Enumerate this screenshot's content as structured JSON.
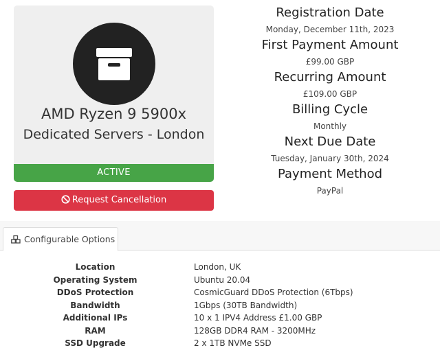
{
  "product": {
    "name": "AMD Ryzen 9 5900x",
    "group": "Dedicated Servers - London",
    "icon": "archive-box-icon",
    "status": "ACTIVE",
    "status_color": "#47a447"
  },
  "actions": {
    "cancel_label": "Request Cancellation",
    "cancel_icon": "ban-icon",
    "cancel_color": "#dc3545"
  },
  "billing": {
    "registration_date_label": "Registration Date",
    "registration_date": "Monday, December 11th, 2023",
    "first_payment_label": "First Payment Amount",
    "first_payment": "£99.00 GBP",
    "recurring_label": "Recurring Amount",
    "recurring": "£109.00 GBP",
    "billing_cycle_label": "Billing Cycle",
    "billing_cycle": "Monthly",
    "next_due_label": "Next Due Date",
    "next_due": "Tuesday, January 30th, 2024",
    "payment_method_label": "Payment Method",
    "payment_method": "PayPal"
  },
  "tabs": [
    {
      "label": "Configurable Options",
      "icon": "cubes-icon",
      "active": true
    }
  ],
  "configurable_options": [
    {
      "label": "Location",
      "value": "London, UK"
    },
    {
      "label": "Operating System",
      "value": "Ubuntu 20.04"
    },
    {
      "label": "DDoS Protection",
      "value": "CosmicGuard DDoS Protection (6Tbps)"
    },
    {
      "label": "Bandwidth",
      "value": "1Gbps (30TB Bandwidth)"
    },
    {
      "label": "Additional IPs",
      "value": "10 x 1 IPV4 Address £1.00 GBP"
    },
    {
      "label": "RAM",
      "value": "128GB DDR4 RAM - 3200MHz"
    },
    {
      "label": "SSD Upgrade",
      "value": "2 x 1TB NVMe SSD"
    }
  ]
}
